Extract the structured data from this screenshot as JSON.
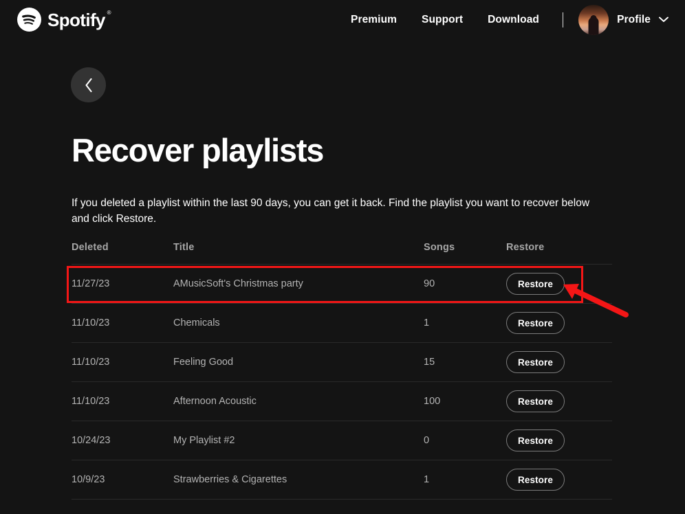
{
  "brand": {
    "name": "Spotify",
    "registered": "®",
    "icon": "spotify-logo-icon"
  },
  "nav": {
    "links": [
      {
        "label": "Premium"
      },
      {
        "label": "Support"
      },
      {
        "label": "Download"
      }
    ],
    "profile": {
      "label": "Profile",
      "caret_icon": "chevron-down-icon",
      "avatar_icon": "user-avatar"
    }
  },
  "back_button": {
    "icon": "chevron-left-icon",
    "label": "Back"
  },
  "page": {
    "title": "Recover playlists",
    "intro": "If you deleted a playlist within the last 90 days, you can get it back. Find the playlist you want to recover below and click Restore."
  },
  "table": {
    "columns": [
      "Deleted",
      "Title",
      "Songs",
      "Restore"
    ],
    "restore_label": "Restore",
    "rows": [
      {
        "deleted": "11/27/23",
        "title": "AMusicSoft's Christmas party",
        "songs": "90",
        "action": "Restore",
        "highlighted": true
      },
      {
        "deleted": "11/10/23",
        "title": "Chemicals",
        "songs": "1",
        "action": "Restore",
        "highlighted": false
      },
      {
        "deleted": "11/10/23",
        "title": "Feeling Good",
        "songs": "15",
        "action": "Restore",
        "highlighted": false
      },
      {
        "deleted": "11/10/23",
        "title": "Afternoon Acoustic",
        "songs": "100",
        "action": "Restore",
        "highlighted": false
      },
      {
        "deleted": "10/24/23",
        "title": "My Playlist #2",
        "songs": "0",
        "action": "Restore",
        "highlighted": false
      },
      {
        "deleted": "10/9/23",
        "title": "Strawberries & Cigarettes",
        "songs": "1",
        "action": "Restore",
        "highlighted": false
      }
    ]
  },
  "annotation": {
    "color": "#f41616",
    "highlight_target": "AMusicSoft's Christmas party",
    "arrow_points_to": "Restore"
  },
  "colors": {
    "background": "#141414",
    "text_primary": "#ffffff",
    "text_secondary": "#b3b3b3",
    "header_text": "#a7a7a7",
    "divider": "#2a2a2a",
    "back_button_bg": "#333333",
    "annotation_red": "#f41616"
  }
}
